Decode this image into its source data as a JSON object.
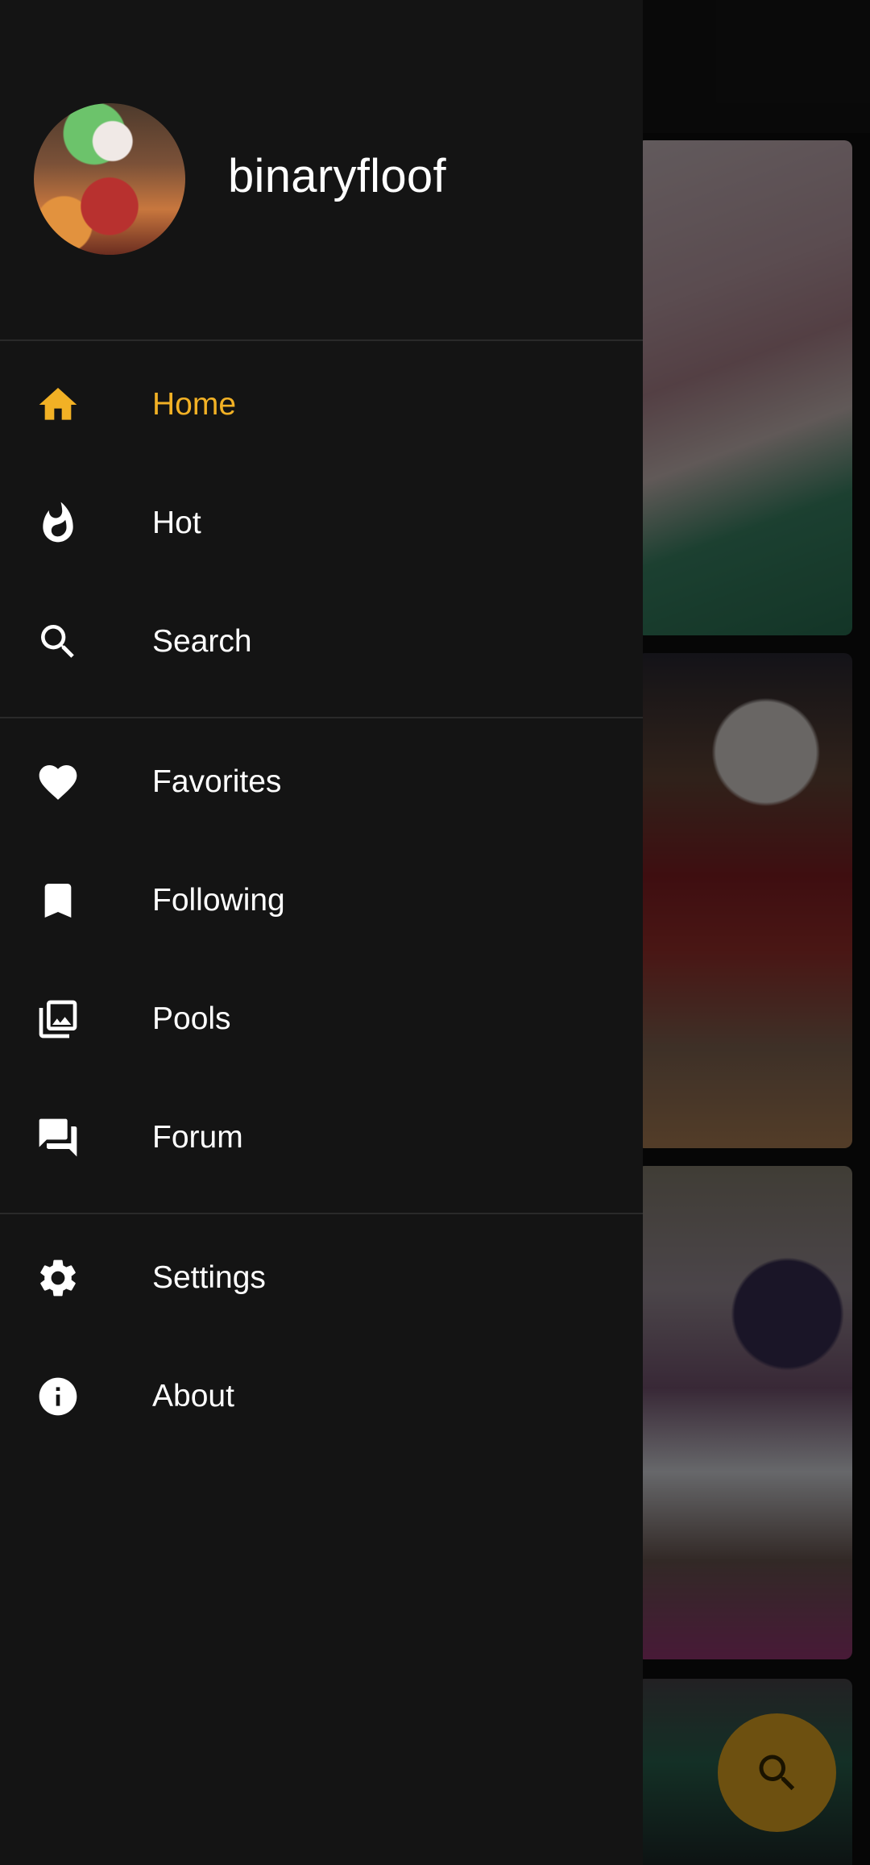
{
  "colors": {
    "accent": "#f2b125",
    "drawer_bg": "#141414",
    "text": "#ffffff",
    "divider": "#2a2a2a"
  },
  "drawer": {
    "username": "binaryfloof",
    "groups": [
      [
        {
          "label": "Home",
          "icon": "home-icon",
          "active": true
        },
        {
          "label": "Hot",
          "icon": "fire-icon"
        },
        {
          "label": "Search",
          "icon": "search-icon"
        }
      ],
      [
        {
          "label": "Favorites",
          "icon": "heart-icon"
        },
        {
          "label": "Following",
          "icon": "bookmark-icon"
        },
        {
          "label": "Pools",
          "icon": "photo-library-icon"
        },
        {
          "label": "Forum",
          "icon": "forum-icon"
        }
      ],
      [
        {
          "label": "Settings",
          "icon": "gear-icon"
        },
        {
          "label": "About",
          "icon": "info-icon"
        }
      ]
    ]
  },
  "fab": {
    "icon": "search-icon"
  }
}
